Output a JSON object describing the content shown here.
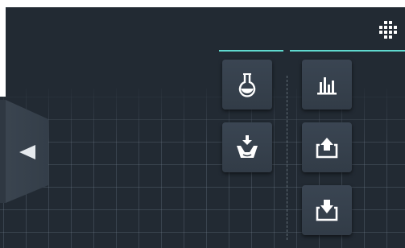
{
  "toolbar": {
    "menu_icon": "grid-menu-icon",
    "accent_color": "#5fd9cf",
    "tools_left": [
      {
        "id": "chemistry",
        "icon": "flask-icon"
      },
      {
        "id": "dispense",
        "icon": "basket-download-icon"
      }
    ],
    "tools_right": [
      {
        "id": "statistics",
        "icon": "bar-chart-icon"
      },
      {
        "id": "upload",
        "icon": "upload-tray-icon"
      },
      {
        "id": "download",
        "icon": "download-tray-icon"
      }
    ]
  },
  "side_panel": {
    "toggle_icon": "collapse-left-arrow-icon"
  }
}
